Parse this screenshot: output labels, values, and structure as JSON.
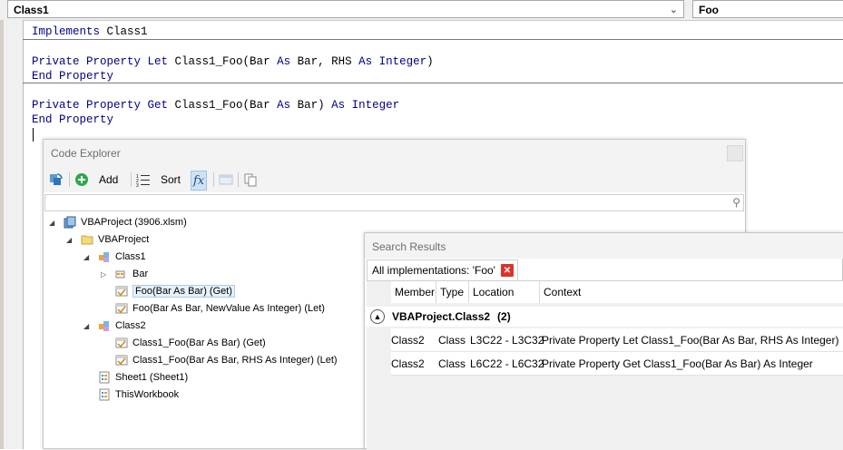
{
  "top_bar": {
    "object_dropdown": "Class1",
    "procedure_dropdown": "Foo"
  },
  "code": {
    "lines": [
      "Implements Class1",
      "Private Property Let Class1_Foo(Bar As Bar, RHS As Integer)",
      "End Property",
      "Private Property Get Class1_Foo(Bar As Bar) As Integer",
      "End Property"
    ]
  },
  "code_explorer": {
    "title": "Code Explorer",
    "toolbar": {
      "add_label": "Add",
      "sort_label": "Sort",
      "fx_label": "fx"
    },
    "search_placeholder": "",
    "tree": [
      "VBAProject (3906.xlsm)",
      "VBAProject",
      "Class1",
      "Bar",
      "Foo(Bar As Bar) (Get)",
      "Foo(Bar As Bar, NewValue As Integer) (Let)",
      "Class2",
      "Class1_Foo(Bar As Bar) (Get)",
      "Class1_Foo(Bar As Bar, RHS As Integer) (Let)",
      "Sheet1 (Sheet1)",
      "ThisWorkbook"
    ]
  },
  "search_results": {
    "title": "Search Results",
    "tab_label": "All implementations: 'Foo'",
    "columns": [
      "Member",
      "Type",
      "Location",
      "Context"
    ],
    "group_label": "VBAProject.Class2",
    "group_count": "(2)",
    "rows": [
      {
        "member": "Class2",
        "type": "Class",
        "location": "L3C22 - L3C32",
        "context": "Private Property Let Class1_Foo(Bar As Bar, RHS As Integer)"
      },
      {
        "member": "Class2",
        "type": "Class",
        "location": "L6C22 - L6C32",
        "context": "Private Property Get Class1_Foo(Bar As Bar) As Integer"
      }
    ]
  }
}
